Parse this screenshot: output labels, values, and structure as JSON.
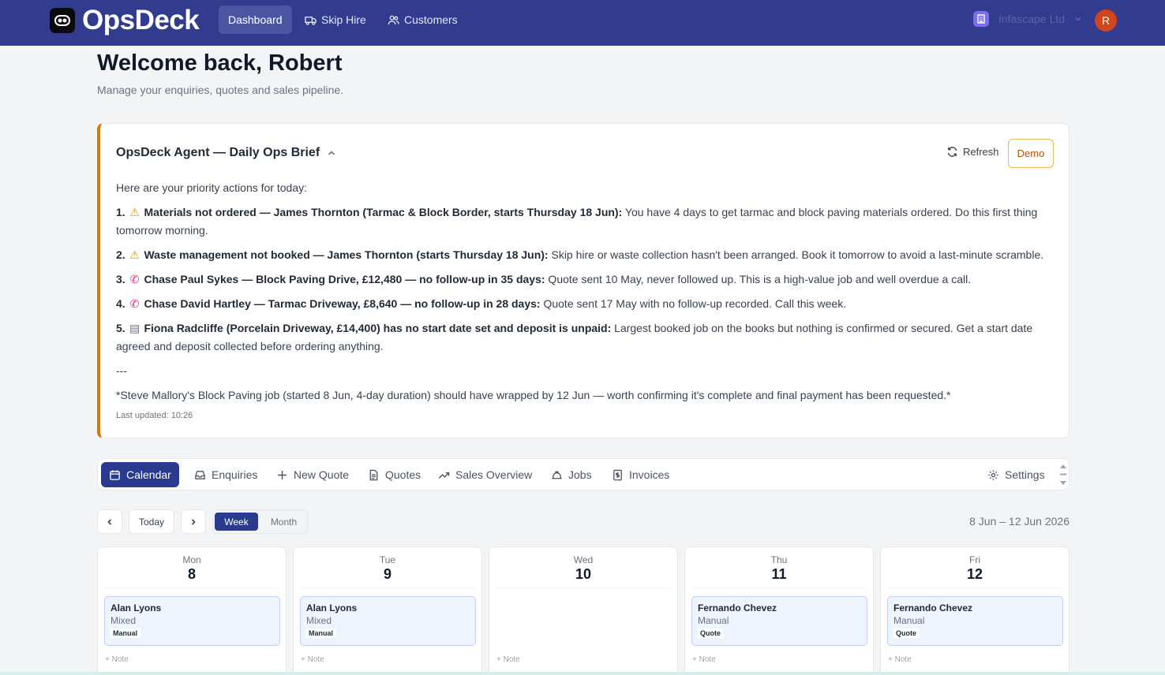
{
  "app": {
    "name": "OpsDeck",
    "nav": [
      {
        "label": "Dashboard",
        "icon": "home-icon",
        "active": true
      },
      {
        "label": "Skip Hire",
        "icon": "truck-icon",
        "active": false
      },
      {
        "label": "Customers",
        "icon": "users-icon",
        "active": false
      }
    ],
    "org_name": "Infascape Ltd",
    "avatar_initial": "R"
  },
  "header": {
    "title": "Welcome back, Robert",
    "subtitle": "Manage your enquiries, quotes and sales pipeline."
  },
  "brief": {
    "title": "OpsDeck Agent — Daily Ops Brief",
    "refresh_label": "Refresh",
    "demo_label": "Demo",
    "intro": "Here are your priority actions for today:",
    "items": [
      {
        "num": "1.",
        "glyph": "⚠️",
        "bold": "Materials not ordered — James Thornton (Tarmac & Block Border, starts Thursday 18 Jun):",
        "text": " You have 4 days to get tarmac and block paving materials ordered. Do this first thing tomorrow morning."
      },
      {
        "num": "2.",
        "glyph": "⚠️",
        "bold": "Waste management not booked — James Thornton (starts Thursday 18 Jun):",
        "text": " Skip hire or waste collection hasn't been arranged. Book it tomorrow to avoid a last-minute scramble."
      },
      {
        "num": "3.",
        "glyph": "📞",
        "bold": "Chase Paul Sykes — Block Paving Drive, £12,480 — no follow-up in 35 days:",
        "text": " Quote sent 10 May, never followed up. This is a high-value job and well overdue a call."
      },
      {
        "num": "4.",
        "glyph": "📞",
        "bold": "Chase David Hartley — Tarmac Driveway, £8,640 — no follow-up in 28 days:",
        "text": " Quote sent 17 May with no follow-up recorded. Call this week."
      },
      {
        "num": "5.",
        "glyph": "📋",
        "bold": "Fiona Radcliffe (Porcelain Driveway, £14,400) has no start date set and deposit is unpaid:",
        "text": " Largest booked job on the books but nothing is confirmed or secured. Get a start date agreed and deposit collected before ordering anything."
      }
    ],
    "separator": "---",
    "footnote": "*Steve Mallory's Block Paving job (started 8 Jun, 4-day duration) should have wrapped by 12 Jun — worth confirming it's complete and final payment has been requested.*",
    "last_updated": "Last updated: 10:26"
  },
  "tabs": [
    {
      "label": "Calendar",
      "icon": "calendar-icon",
      "active": true
    },
    {
      "label": "Enquiries",
      "icon": "inbox-icon",
      "active": false
    },
    {
      "label": "New Quote",
      "icon": "plus-icon",
      "active": false
    },
    {
      "label": "Quotes",
      "icon": "document-icon",
      "active": false
    },
    {
      "label": "Sales Overview",
      "icon": "trending-up-icon",
      "active": false
    },
    {
      "label": "Jobs",
      "icon": "hard-hat-icon",
      "active": false
    },
    {
      "label": "Invoices",
      "icon": "invoice-icon",
      "active": false
    },
    {
      "label": "Settings",
      "icon": "gear-icon",
      "active": false
    }
  ],
  "calendar": {
    "today_label": "Today",
    "view_week": "Week",
    "view_month": "Month",
    "date_range": "8 Jun – 12 Jun 2026",
    "note_label": "+ Note",
    "days": [
      {
        "name": "Mon",
        "num": "8",
        "job": {
          "name": "Alan Lyons",
          "type": "Mixed",
          "tag": "Manual"
        }
      },
      {
        "name": "Tue",
        "num": "9",
        "job": {
          "name": "Alan Lyons",
          "type": "Mixed",
          "tag": "Manual"
        }
      },
      {
        "name": "Wed",
        "num": "10",
        "job": null
      },
      {
        "name": "Thu",
        "num": "11",
        "job": {
          "name": "Fernando Chevez",
          "type": "Manual",
          "tag": "Quote"
        }
      },
      {
        "name": "Fri",
        "num": "12",
        "job": {
          "name": "Fernando Chevez",
          "type": "Manual",
          "tag": "Quote"
        }
      }
    ]
  },
  "colors": {
    "nav_bg": "#313c8f",
    "accent": "#2a3a8f",
    "brief_border": "#d97706",
    "avatar": "#d0451b"
  }
}
